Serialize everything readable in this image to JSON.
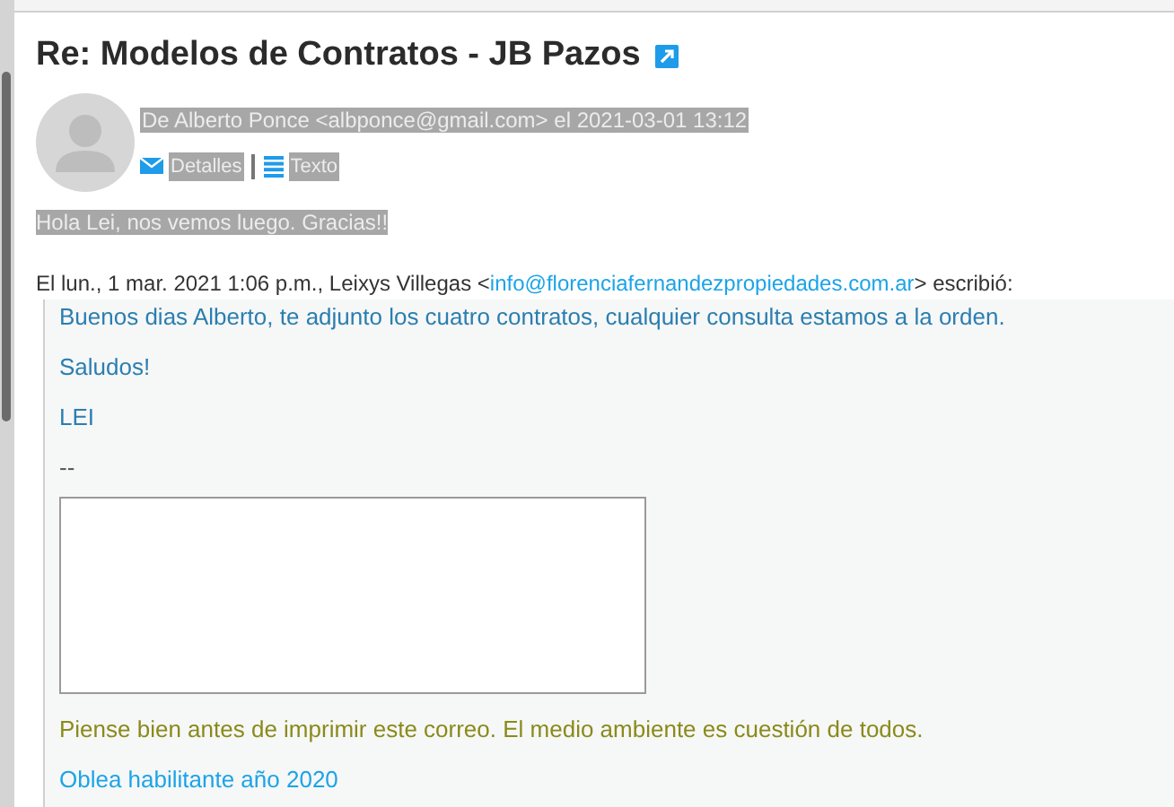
{
  "subject": "Re: Modelos de Contratos - JB Pazos",
  "header": {
    "from_line": "De Alberto Ponce <albponce@gmail.com> el 2021-03-01 13:12",
    "selected": true
  },
  "actions": [
    {
      "kind": "details",
      "label": "Detalles",
      "selected": true
    },
    {
      "kind": "text",
      "label": "Texto",
      "selected": true
    }
  ],
  "reply": {
    "text": "Hola Lei, nos vemos luego. Gracias!!",
    "selected": true
  },
  "quote_intro": {
    "before": "El lun., 1 mar. 2021 1:06 p.m., Leixys Villegas <",
    "link": "info@florenciafernandezpropiedades.com.ar",
    "after": "> escribió:"
  },
  "quoted": [
    {
      "kind": "text",
      "text": "Buenos dias Alberto, te adjunto los cuatro contratos, cualquier consulta estamos a la orden."
    },
    {
      "kind": "text",
      "text": "Saludos!"
    },
    {
      "kind": "text",
      "text": "LEI"
    },
    {
      "kind": "signature",
      "text": "--"
    },
    {
      "kind": "image"
    },
    {
      "kind": "notice",
      "text": "Piense bien antes de imprimir este correo. El medio ambiente es cuestión de todos."
    },
    {
      "kind": "link",
      "text": "Oblea habilitante año 2020"
    }
  ]
}
